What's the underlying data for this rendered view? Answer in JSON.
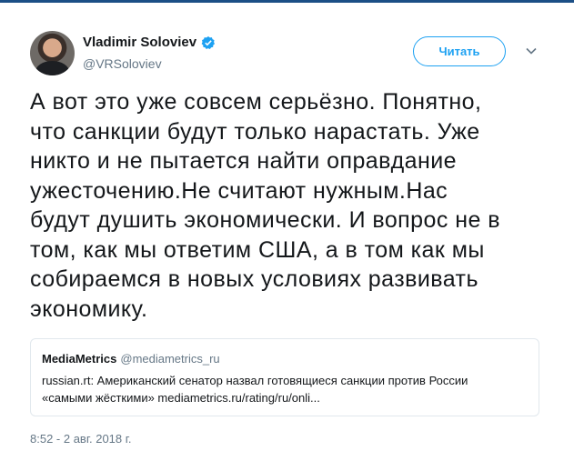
{
  "author": {
    "display_name": "Vladimir Soloviev",
    "handle": "@VRSoloviev",
    "verified_icon": "verified-badge-icon"
  },
  "follow_button_label": "Читать",
  "menu_icon": "chevron-down-icon",
  "tweet": {
    "lines": [
      "А вот это уже совсем серьёзно. Понятно,",
      "что санкции будут только нарастать. Уже",
      "никто и не пытается найти оправдание",
      "ужесточению.Не считают нужным.Нас",
      "будут душить экономически. И вопрос не в",
      "том, как мы ответим США, а в том как мы",
      "собираемся в новых условиях развивать",
      "экономику."
    ]
  },
  "quoted_tweet": {
    "display_name": "MediaMetrics",
    "handle": "@mediametrics_ru",
    "lines": [
      "russian.rt: Американский сенатор назвал готовящиеся санкции против России",
      "«самыми жёсткими» mediametrics.ru/rating/ru/onli..."
    ]
  },
  "timestamp": "8:52 - 2 авг. 2018 г.",
  "colors": {
    "accent": "#1da1f2",
    "secondary_text": "#657786",
    "border": "#e1e8ed"
  }
}
